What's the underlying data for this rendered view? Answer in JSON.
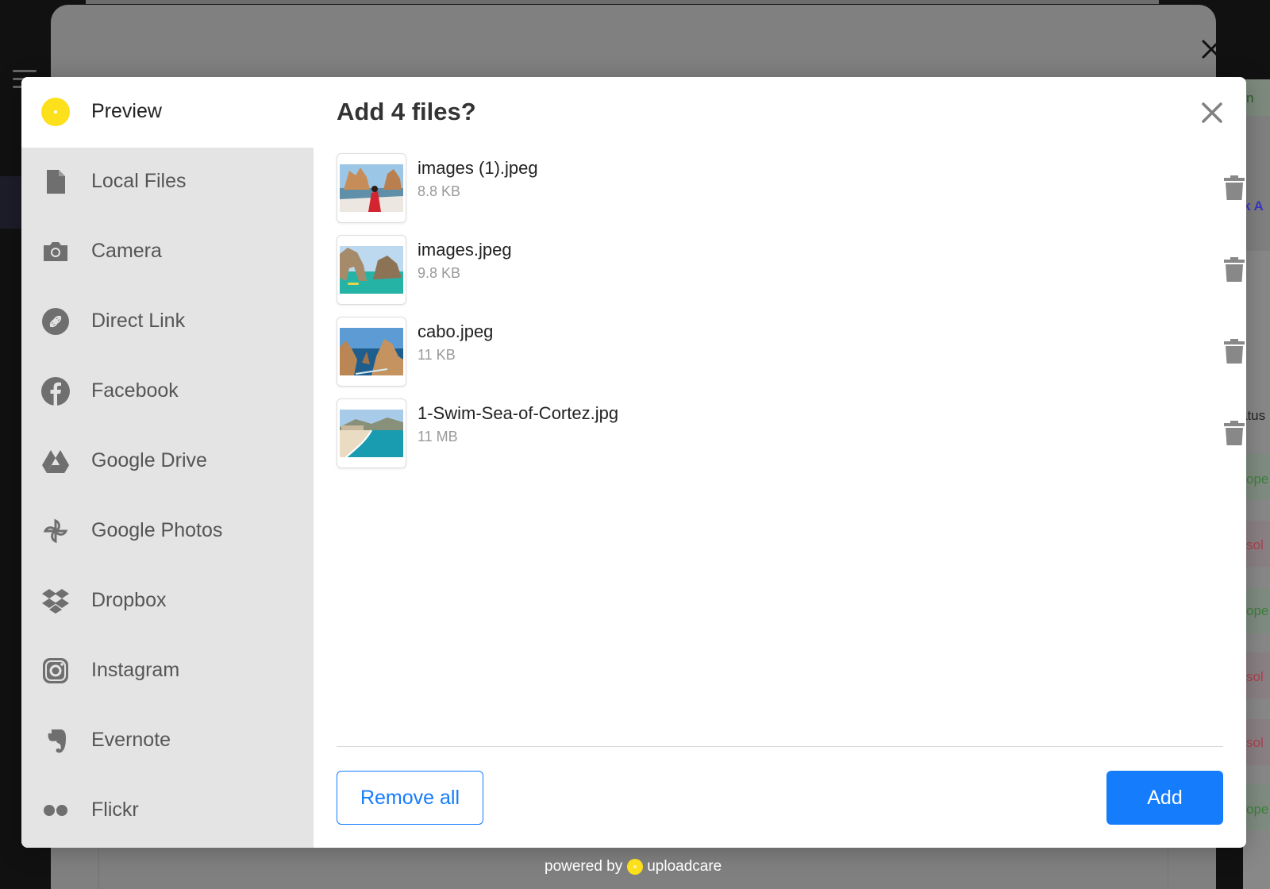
{
  "dialog": {
    "title": "Add 4 files?",
    "accent_color": "#157cfc",
    "brand_color": "#fde01c"
  },
  "sidebar": {
    "items": [
      {
        "label": "Preview",
        "icon": "preview-dot-icon",
        "active": true
      },
      {
        "label": "Local Files",
        "icon": "file-icon"
      },
      {
        "label": "Camera",
        "icon": "camera-icon"
      },
      {
        "label": "Direct Link",
        "icon": "link-icon"
      },
      {
        "label": "Facebook",
        "icon": "facebook-icon"
      },
      {
        "label": "Google Drive",
        "icon": "google-drive-icon"
      },
      {
        "label": "Google Photos",
        "icon": "google-photos-icon"
      },
      {
        "label": "Dropbox",
        "icon": "dropbox-icon"
      },
      {
        "label": "Instagram",
        "icon": "instagram-icon"
      },
      {
        "label": "Evernote",
        "icon": "evernote-icon"
      },
      {
        "label": "Flickr",
        "icon": "flickr-icon"
      }
    ]
  },
  "files": [
    {
      "name": "images (1).jpeg",
      "size": "8.8 KB"
    },
    {
      "name": "images.jpeg",
      "size": "9.8 KB"
    },
    {
      "name": "cabo.jpeg",
      "size": "11 KB"
    },
    {
      "name": "1-Swim-Sea-of-Cortez.jpg",
      "size": "11 MB"
    }
  ],
  "actions": {
    "remove_all_label": "Remove all",
    "add_label": "Add"
  },
  "footer": {
    "powered_by": "powered by",
    "brand": "uploadcare"
  },
  "background": {
    "snippets": [
      "n",
      "k A",
      "atus",
      "ope",
      "sol",
      "ope",
      "sol",
      "sol",
      "ope"
    ]
  }
}
